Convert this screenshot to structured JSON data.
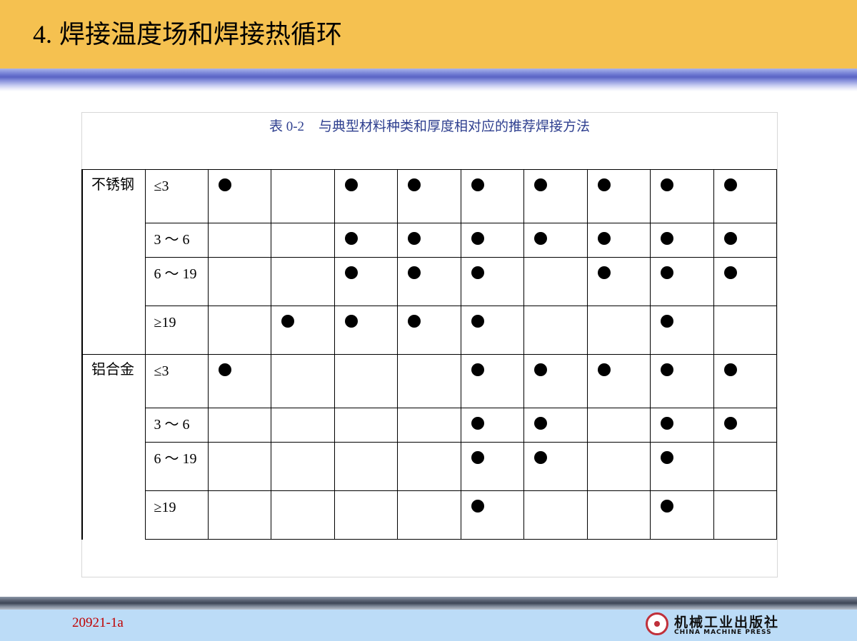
{
  "slide": {
    "title_number": "4.",
    "title_text": "焊接温度场和焊接热循环"
  },
  "table": {
    "caption_label": "表 0-2",
    "caption_text": "与典型材料种类和厚度相对应的推荐焊接方法",
    "groups": [
      {
        "material": "不锈钢",
        "rows": [
          {
            "thickness": "≤3",
            "marks": [
              1,
              0,
              1,
              1,
              1,
              1,
              1,
              1,
              1
            ]
          },
          {
            "thickness": "3 ～ 6",
            "marks": [
              0,
              0,
              1,
              1,
              1,
              1,
              1,
              1,
              1
            ]
          },
          {
            "thickness": "6 ～ 19",
            "marks": [
              0,
              0,
              1,
              1,
              1,
              0,
              1,
              1,
              1
            ]
          },
          {
            "thickness": "≥19",
            "marks": [
              0,
              1,
              1,
              1,
              1,
              0,
              0,
              1,
              0
            ]
          }
        ]
      },
      {
        "material": "铝合金",
        "rows": [
          {
            "thickness": "≤3",
            "marks": [
              1,
              0,
              0,
              0,
              1,
              1,
              1,
              1,
              1
            ]
          },
          {
            "thickness": "3 ～ 6",
            "marks": [
              0,
              0,
              0,
              0,
              1,
              1,
              0,
              1,
              1
            ]
          },
          {
            "thickness": "6 ～ 19",
            "marks": [
              0,
              0,
              0,
              0,
              1,
              1,
              0,
              1,
              0
            ]
          },
          {
            "thickness": "≥19",
            "marks": [
              0,
              0,
              0,
              0,
              1,
              0,
              0,
              1,
              0
            ]
          }
        ]
      }
    ]
  },
  "footer": {
    "code": "20921-1a",
    "logo_cn": "机械工业出版社",
    "logo_en": "CHINA MACHINE PRESS"
  }
}
